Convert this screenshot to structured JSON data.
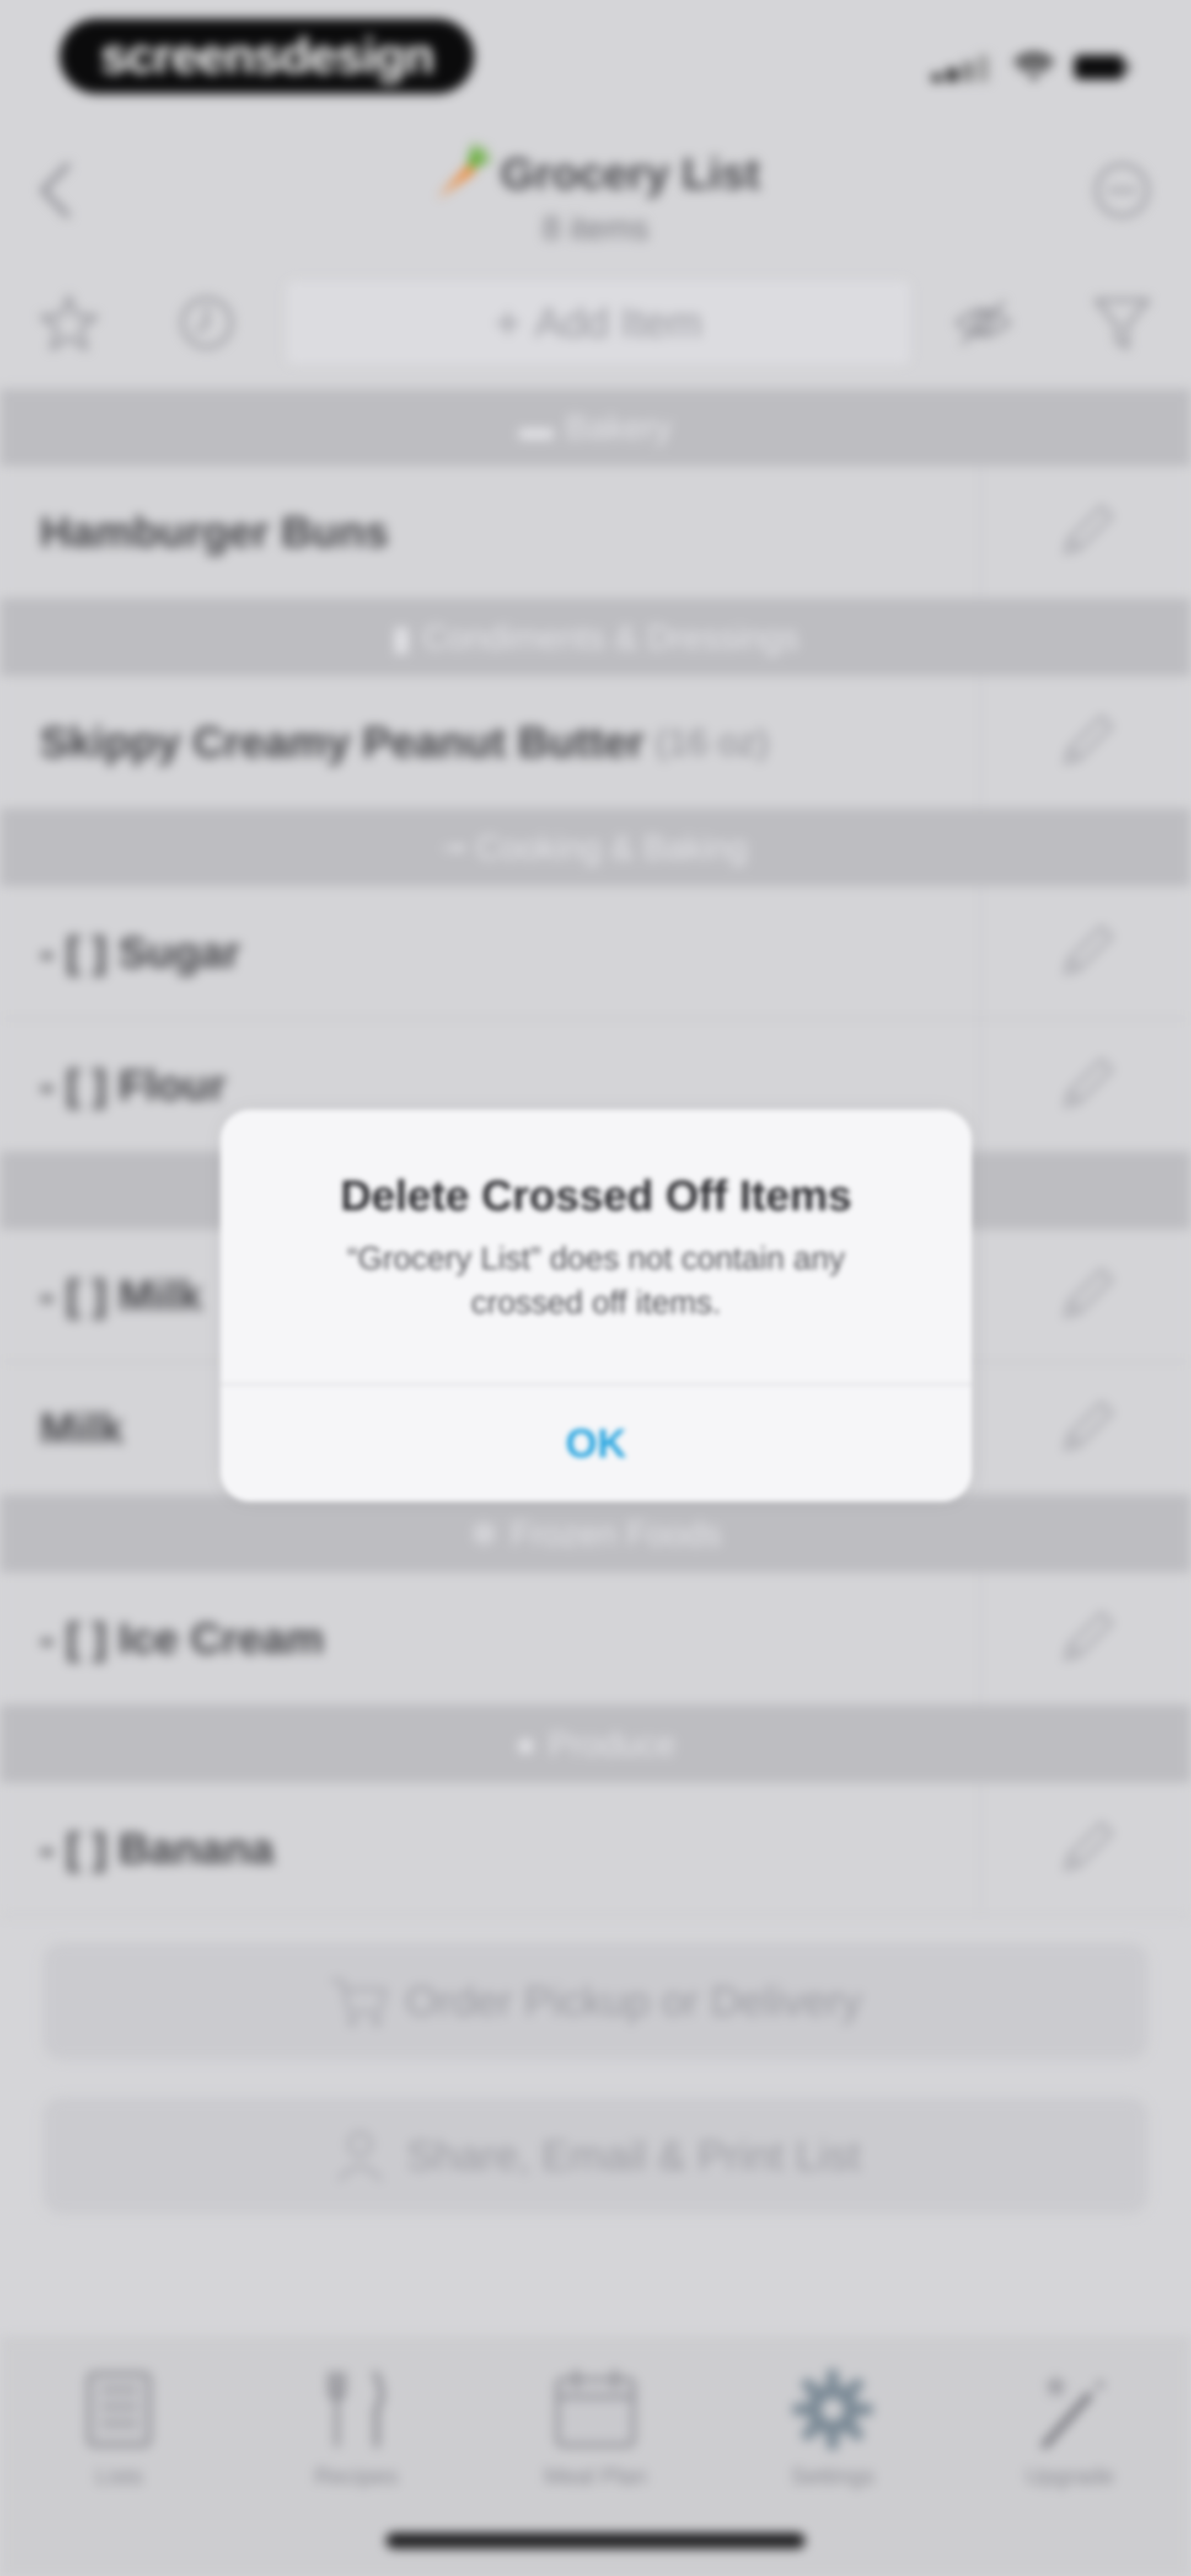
{
  "status_bar": {
    "brand": "screensdesign"
  },
  "nav": {
    "title": "Grocery List",
    "subtitle": "8 items",
    "icons": [
      "back-chevron-icon",
      "carrot-icon",
      "more-circle-icon"
    ]
  },
  "toolbar": {
    "add_item_label": "Add Item",
    "icons": [
      "star-icon",
      "history-icon",
      "plus-icon",
      "hide-crossed-icon",
      "filter-icon"
    ]
  },
  "sections": [
    {
      "header": "Bakery",
      "items": [
        {
          "name": "Hamburger Buns",
          "qty": ""
        }
      ]
    },
    {
      "header": "Condiments & Dressings",
      "items": [
        {
          "name": "Skippy Creamy Peanut Butter",
          "qty": "(16 oz)"
        }
      ]
    },
    {
      "header": "Cooking & Baking",
      "items": [
        {
          "name": "- [ ] Sugar",
          "qty": ""
        },
        {
          "name": "- [ ] Flour",
          "qty": ""
        }
      ]
    },
    {
      "header": "",
      "items": [
        {
          "name": "- [ ] Milk",
          "qty": ""
        },
        {
          "name": "Milk",
          "qty": ""
        }
      ]
    },
    {
      "header": "Frozen Foods",
      "items": [
        {
          "name": "- [ ] Ice Cream",
          "qty": ""
        }
      ]
    },
    {
      "header": "Produce",
      "items": [
        {
          "name": "- [ ] Banana",
          "qty": ""
        }
      ]
    }
  ],
  "actions": {
    "order_label": "Order Pickup or Delivery",
    "share_label": "Share, Email & Print List"
  },
  "tabs": [
    {
      "label": "Lists",
      "icon": "lists-icon"
    },
    {
      "label": "Recipes",
      "icon": "recipes-icon"
    },
    {
      "label": "Meal Plan",
      "icon": "meal-plan-icon"
    },
    {
      "label": "Settings",
      "icon": "settings-gear-icon"
    },
    {
      "label": "Upgrade",
      "icon": "upgrade-wand-icon"
    }
  ],
  "alert": {
    "title": "Delete Crossed Off Items",
    "message": "“Grocery List” does not contain any crossed off items.",
    "ok_label": "OK"
  },
  "colors": {
    "accent_blue": "#2AA6E0",
    "carrot_orange": "#F07E1E",
    "carrot_green": "#5DAA2E"
  }
}
